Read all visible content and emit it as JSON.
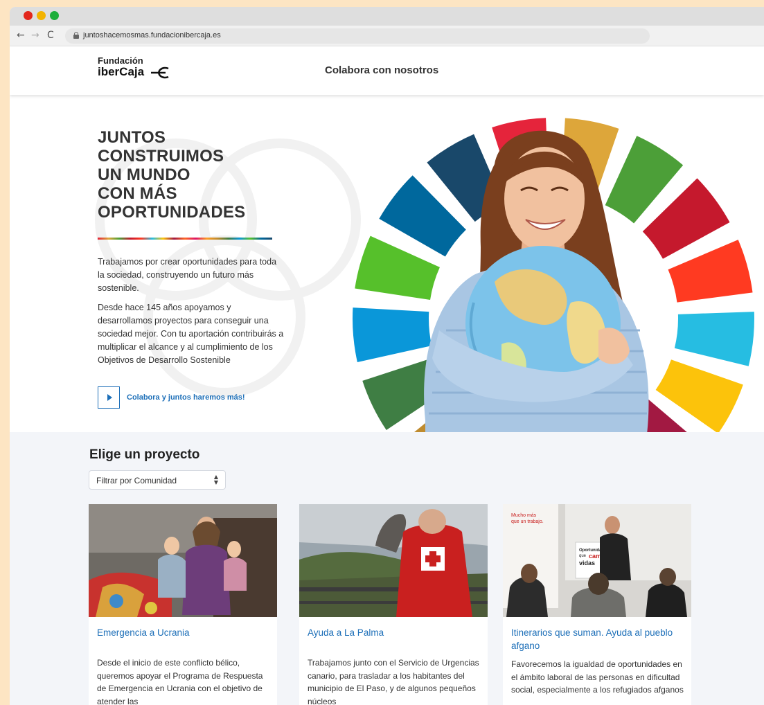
{
  "browser": {
    "url": "juntoshacemosmas.fundacionibercaja.es"
  },
  "header": {
    "logo_line1": "Fundación",
    "logo_line2": "iberCaja",
    "nav_link": "Colabora con nosotros"
  },
  "hero": {
    "title_lines": [
      "JUNTOS",
      "CONSTRUIMOS",
      "UN MUNDO",
      "CON MÁS",
      "OPORTUNIDADES"
    ],
    "paragraph1": "Trabajamos por crear oportunidades para toda la sociedad, construyendo un futuro más sostenible.",
    "paragraph2": "Desde hace 145 años apoyamos y desarrollamos proyectos para conseguir una sociedad mejor. Con tu aportación contribuirás a multiplicar el alcance y al cumplimiento de los Objetivos de Desarrollo Sostenible",
    "cta_label": "Colabora y juntos haremos más!"
  },
  "sdg_colors": [
    "#e5243b",
    "#dda63a",
    "#4c9f38",
    "#c5192d",
    "#ff3a21",
    "#26bde2",
    "#fcc30b",
    "#a21942",
    "#fd6925",
    "#dd1367",
    "#fd9d24",
    "#bf8b2e",
    "#3f7e44",
    "#0a97d9",
    "#56c02b",
    "#00689d",
    "#19486a"
  ],
  "projects": {
    "section_title": "Elige un proyecto",
    "filter_label": "Filtrar por Comunidad",
    "cards": [
      {
        "title": "Emergencia a Ucrania",
        "text": "Desde el inicio de este conflicto bélico, queremos apoyar el Programa de Respuesta de Emergencia en Ucrania con el objetivo de atender las"
      },
      {
        "title": "Ayuda a La Palma",
        "text": "Trabajamos junto con el Servicio de Urgencias canario, para trasladar a los habitantes del municipio de El Paso, y de algunos pequeños núcleos"
      },
      {
        "title": "Itinerarios que suman. Ayuda al pueblo afgano",
        "text": "Favorecemos la igualdad de oportunidades en el ámbito laboral de las personas en dificultad social, especialmente a los refugiados afganos",
        "poster_line1": "Mucho más",
        "poster_line2": "que un trabajo.",
        "poster_line3": "Oportunidades",
        "poster_line4": "que",
        "poster_line5": "cambian",
        "poster_line6": "vidas"
      }
    ]
  },
  "accent": "#1d6fb8"
}
